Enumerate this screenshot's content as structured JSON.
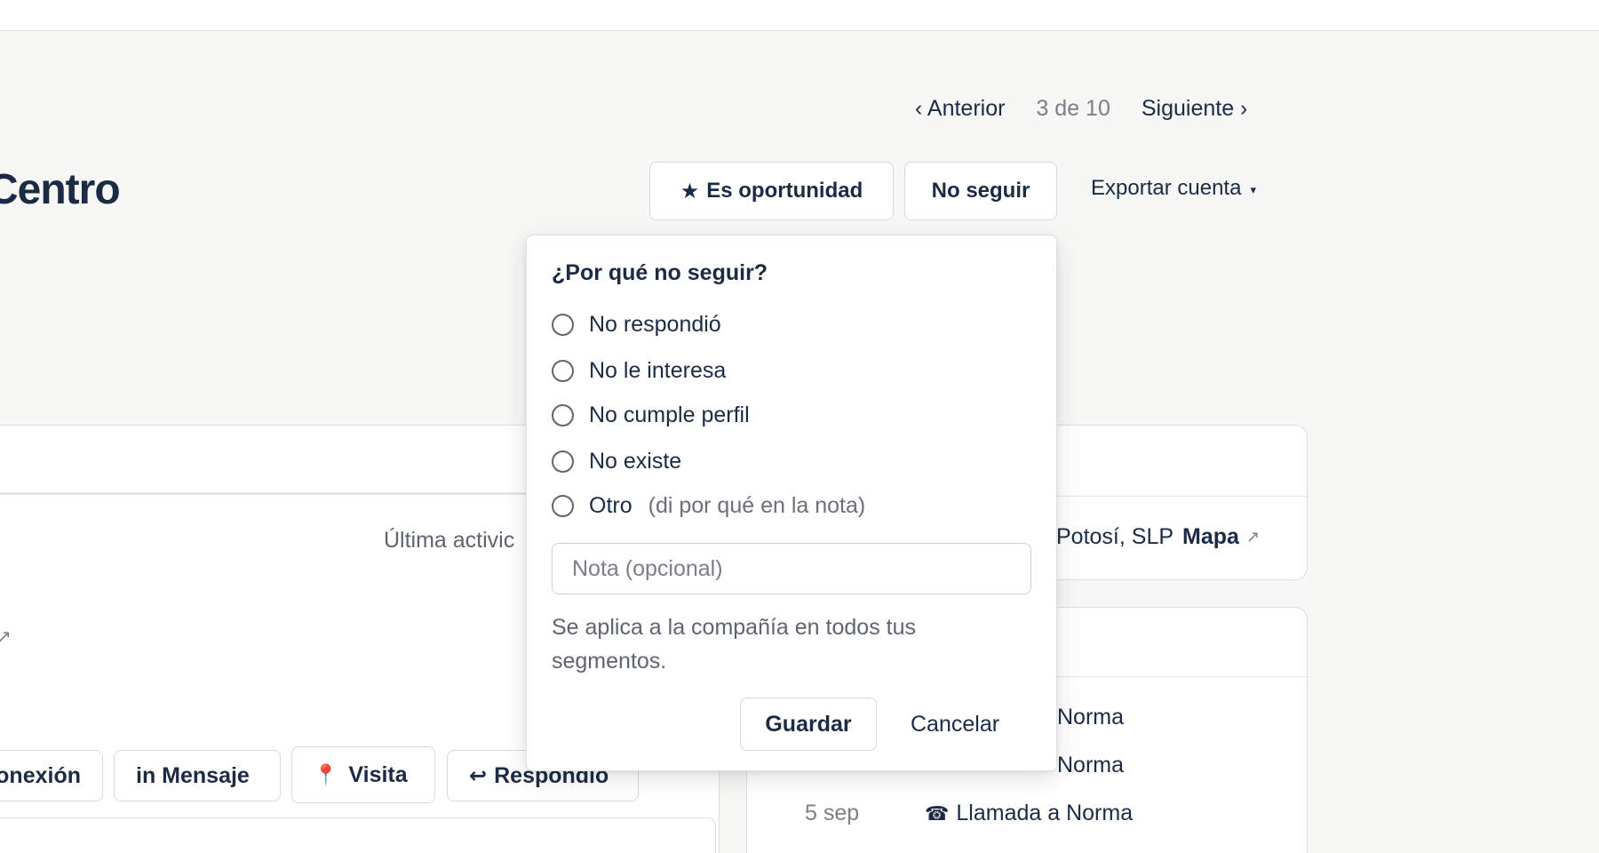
{
  "pager": {
    "prev": "‹ Anterior",
    "count": "3 de 10",
    "next": "Siguiente ›"
  },
  "account": {
    "title": "Centro"
  },
  "actions": {
    "opportunity_icon": "star-icon",
    "opportunity": "Es oportunidad",
    "no_follow": "No seguir",
    "export": "Exportar cuenta",
    "export_caret": "▾"
  },
  "activity": {
    "last_activity": "Última activic",
    "chips": {
      "conexion": "onexión",
      "mensaje": "in Mensaje",
      "visita": "Visita",
      "respondio": "Respondió"
    }
  },
  "location": {
    "text": "Potosí, SLP",
    "map": "Mapa",
    "map_icon": "external-arrow-icon"
  },
  "activity_list": [
    {
      "date": "",
      "label": "Norma"
    },
    {
      "date": "",
      "label": "Norma"
    },
    {
      "date": "5 sep",
      "label": "Llamada a Norma"
    },
    {
      "date": "",
      "label": ""
    }
  ],
  "popover": {
    "title": "¿Por qué no seguir?",
    "options": [
      {
        "label": "No respondió",
        "hint": ""
      },
      {
        "label": "No le interesa",
        "hint": ""
      },
      {
        "label": "No cumple perfil",
        "hint": ""
      },
      {
        "label": "No existe",
        "hint": ""
      },
      {
        "label": "Otro",
        "hint": "(di por qué en la nota)"
      }
    ],
    "note_placeholder": "Nota (opcional)",
    "help": "Se aplica a la compañía en todos tus segmentos.",
    "save": "Guardar",
    "cancel": "Cancelar"
  }
}
